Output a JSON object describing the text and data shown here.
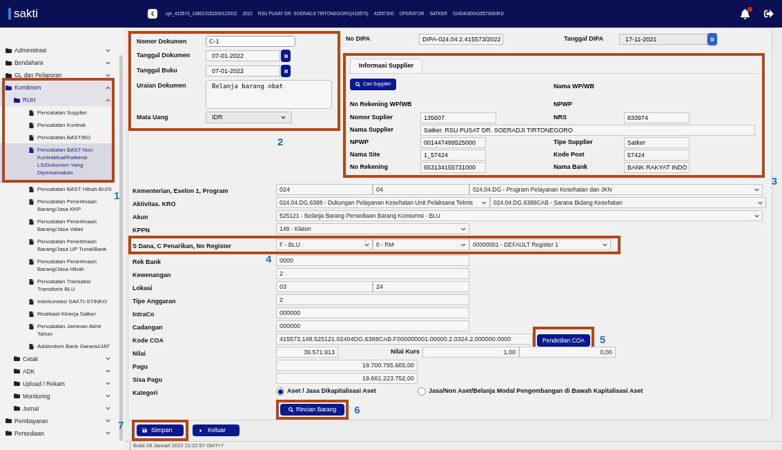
{
  "header": {
    "logo": "sakti",
    "context": [
      "opr_415573_198510152009122002",
      "2022",
      "RSU PUSAT DR. SOERADJI TIRTONEGORO(415573)",
      "41557300",
      "OPERATOR",
      "SATKER",
      "024040300415573000KD"
    ],
    "notifications": {
      "unread": true
    }
  },
  "sidebar": {
    "annotation": "1",
    "items": [
      {
        "label": "Administrasi",
        "kind": "folder",
        "expanded": false
      },
      {
        "label": "Bendahara",
        "kind": "folder",
        "expanded": false
      },
      {
        "label": "GL dan Pelaporan",
        "kind": "folder",
        "expanded": false
      },
      {
        "label": "Komitmen",
        "kind": "folder",
        "expanded": true,
        "children": [
          {
            "label": "RUH",
            "kind": "folder",
            "expanded": true,
            "children": [
              {
                "label": "Pencatatan Supplier",
                "kind": "page",
                "selected": false
              },
              {
                "label": "Pencatatan Kontrak",
                "kind": "page",
                "selected": false
              },
              {
                "label": "Pencatatan BAST/BG",
                "kind": "page",
                "selected": false
              },
              {
                "label": "Pencatatan BAST Non Kontraktual/Kwitansi LS/Dokumen Yang Dipersamakan",
                "kind": "page",
                "selected": true
              },
              {
                "label": "Pencatatan BAST Hibah B/J/S",
                "kind": "page",
                "selected": false
              },
              {
                "label": "Pencatatan Penerimaan Barang/Jasa KKP",
                "kind": "page",
                "selected": false
              },
              {
                "label": "Pencatatan Penerimaan Barang/Jasa Valas",
                "kind": "page",
                "selected": false
              },
              {
                "label": "Pencatatan Penerimaan Barang/Jasa UP Tunai/Bank",
                "kind": "page",
                "selected": false
              },
              {
                "label": "Pencatatan Penerimaan Barang/Jasa Hibah",
                "kind": "page",
                "selected": false
              },
              {
                "label": "Pencatatan Transaksi Transitoris BLU",
                "kind": "page",
                "selected": false
              },
              {
                "label": "Interkoneksi SAKTI-STINKO",
                "kind": "page",
                "selected": false
              },
              {
                "label": "Realisasi Kinerja Satker",
                "kind": "page",
                "selected": false
              },
              {
                "label": "Pencatatan Jaminan Akhir Tahun",
                "kind": "page",
                "selected": false
              },
              {
                "label": "Addendum Bank Garansi/JAT",
                "kind": "page",
                "selected": false
              }
            ]
          },
          {
            "label": "Cetak",
            "kind": "folder",
            "expanded": false
          },
          {
            "label": "ADK",
            "kind": "folder",
            "expanded": false
          },
          {
            "label": "Upload / Rekam",
            "kind": "folder",
            "expanded": false
          },
          {
            "label": "Monitoring",
            "kind": "folder",
            "expanded": false
          },
          {
            "label": "Jurnal",
            "kind": "folder",
            "expanded": false
          }
        ]
      },
      {
        "label": "Pembayaran",
        "kind": "folder",
        "expanded": false
      },
      {
        "label": "Persediaan",
        "kind": "folder",
        "expanded": false
      }
    ]
  },
  "document": {
    "annotation": "2",
    "fields": [
      {
        "label": "Nomor Dokumen",
        "kind": "text",
        "value": "C-1"
      },
      {
        "label": "Tanggal Dokumen",
        "kind": "date",
        "value": "07-01-2022"
      },
      {
        "label": "Tanggal Buku",
        "kind": "date",
        "value": "07-01-2022"
      },
      {
        "label": "Uraian Dokumen",
        "kind": "textarea",
        "value": "Belanja barang obat"
      },
      {
        "label": "Mata Uang",
        "kind": "select",
        "value": "IDR"
      }
    ]
  },
  "dipa": [
    {
      "label": "No DIPA",
      "kind": "text",
      "value": "DIPA-024.04.2.415573/2022"
    },
    {
      "label": "Tanggal DIPA",
      "kind": "date",
      "value": "17-11-2021"
    }
  ],
  "supplier": {
    "annotation": "3",
    "tab": "Informasi Supplier",
    "rows": [
      {
        "cells": [
          {
            "kind": "button",
            "label": "Cari Supplier"
          },
          {
            "kind": "label",
            "label": "Nama WP/WB"
          }
        ]
      },
      {
        "cells": [
          {
            "kind": "label",
            "label": "No Rekening WP/WB"
          },
          {
            "kind": "label",
            "label": "NPWP"
          }
        ]
      },
      {
        "cells": [
          {
            "kind": "field",
            "label": "Nomor Suplier",
            "value": "135607"
          },
          {
            "kind": "field",
            "label": "NRS",
            "value": "833974"
          }
        ]
      },
      {
        "cells": [
          {
            "kind": "wide",
            "label": "Nama Supplier",
            "value": "Satker. RSU PUSAT DR. SOERADJI TIRTONEGORO"
          }
        ]
      },
      {
        "cells": [
          {
            "kind": "field",
            "label": "NPWP",
            "value": "001447499525000"
          },
          {
            "kind": "field",
            "label": "Tipe Supplier",
            "value": "Satker"
          }
        ]
      },
      {
        "cells": [
          {
            "kind": "field",
            "label": "Nama Site",
            "value": "1_57424"
          },
          {
            "kind": "field",
            "label": "Kode Post",
            "value": "57424"
          }
        ]
      },
      {
        "cells": [
          {
            "kind": "field",
            "label": "No Rekening",
            "value": "653134155731000"
          },
          {
            "kind": "field",
            "label": "Nama Bank",
            "value": "BANK RAKYAT INDO"
          }
        ]
      }
    ]
  },
  "form": {
    "rows": [
      {
        "label": "Kementerian, Eselon 1, Program",
        "fields": [
          {
            "kind": "text",
            "value": "024"
          },
          {
            "kind": "text",
            "value": "04"
          },
          {
            "kind": "select",
            "value": "024.04.DG - Program Pelayanan Kesehatan dan JKN"
          }
        ]
      },
      {
        "label": "Aktivitas. KRO",
        "fields": [
          {
            "kind": "select",
            "value": "024.04.DG.6388 - Dukungan Pelayanan Kesehatan Unit Pelaksana Teknis"
          },
          {
            "kind": "select",
            "value": "024.04.DG.6388CAB - Sarana Bidang Kesehatan"
          }
        ]
      },
      {
        "label": "Akun",
        "fields": [
          {
            "kind": "select",
            "value": "525121 - Belanja Barang Persediaan Barang Konsumsi - BLU"
          }
        ]
      },
      {
        "label": "KPPN",
        "fields": [
          {
            "kind": "select",
            "value": "148 - Klaten"
          }
        ]
      },
      {
        "label": "S Dana, C Penarikan, No Register",
        "annotation": "4",
        "fields": [
          {
            "kind": "select",
            "value": "F - BLU"
          },
          {
            "kind": "select",
            "value": "0 - RM"
          },
          {
            "kind": "select",
            "value": "00000001 - DEFAULT Register 1"
          }
        ]
      },
      {
        "label": "Rek Bank",
        "fields": [
          {
            "kind": "text",
            "value": "0000"
          }
        ]
      },
      {
        "label": "Kewenangan",
        "fields": [
          {
            "kind": "text",
            "value": "2"
          }
        ]
      },
      {
        "label": "Lokasi",
        "fields": [
          {
            "kind": "text",
            "value": "03"
          },
          {
            "kind": "text",
            "value": "24"
          }
        ]
      },
      {
        "label": "Tipe Anggaran",
        "fields": [
          {
            "kind": "text",
            "value": "2"
          }
        ]
      },
      {
        "label": "IntraCo",
        "fields": [
          {
            "kind": "text",
            "value": "000000"
          }
        ]
      },
      {
        "label": "Cadangan",
        "fields": [
          {
            "kind": "text",
            "value": "000000"
          }
        ]
      },
      {
        "label": "Kode COA",
        "fields": [
          {
            "kind": "text",
            "value": "415573.148.525121.02404DG.6388CAB.F000000001.00000.2.0324.2.000000.0000"
          },
          {
            "kind": "button",
            "value": "Pendetilan COA",
            "annotation": "5"
          }
        ]
      },
      {
        "label": "Nilai",
        "fields": [
          {
            "kind": "number",
            "value": "39.571.913"
          },
          {
            "kind": "label",
            "value": "Nilai Kurs"
          },
          {
            "kind": "number",
            "value": "1,00"
          },
          {
            "kind": "number",
            "value": "0,00"
          }
        ]
      },
      {
        "label": "Pagu",
        "fields": [
          {
            "kind": "number",
            "value": "19.700.795.665,00"
          }
        ]
      },
      {
        "label": "Sisa Pagu",
        "fields": [
          {
            "kind": "number",
            "value": "19.661.223.752,00"
          }
        ]
      },
      {
        "label": "Kategori",
        "fields": [
          {
            "kind": "radio",
            "value": "Aset / Jasa Dikapitalisasi Aset",
            "selected": true
          },
          {
            "kind": "radio",
            "value": "Jasa/Non Aset/Belanja Modal Pengembangan di Bawah Kapitalisasi Aset",
            "selected": false
          }
        ]
      }
    ],
    "detail_button": {
      "label": "Rincian Barang",
      "annotation": "6"
    }
  },
  "actions": [
    {
      "label": "Simpan",
      "kind": "save",
      "annotation": "7"
    },
    {
      "label": "Keluar",
      "kind": "exit"
    }
  ],
  "status": "Build 28 Januari 2022 21:31:57 GMT+7"
}
